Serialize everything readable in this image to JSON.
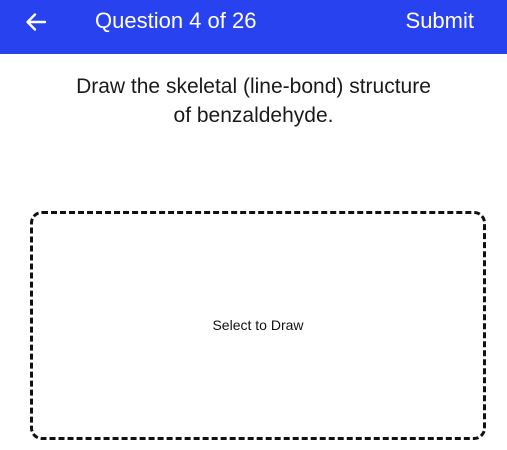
{
  "header": {
    "title": "Question 4 of 26",
    "submit_label": "Submit",
    "back_icon": "arrow-left-icon",
    "background_color": "#2942F0",
    "text_color": "#FFFFFF"
  },
  "question": {
    "line1": "Draw the skeletal (line-bond) structure",
    "line2": "of benzaldehyde."
  },
  "draw_area": {
    "label": "Select to Draw",
    "border_color": "#111111"
  }
}
